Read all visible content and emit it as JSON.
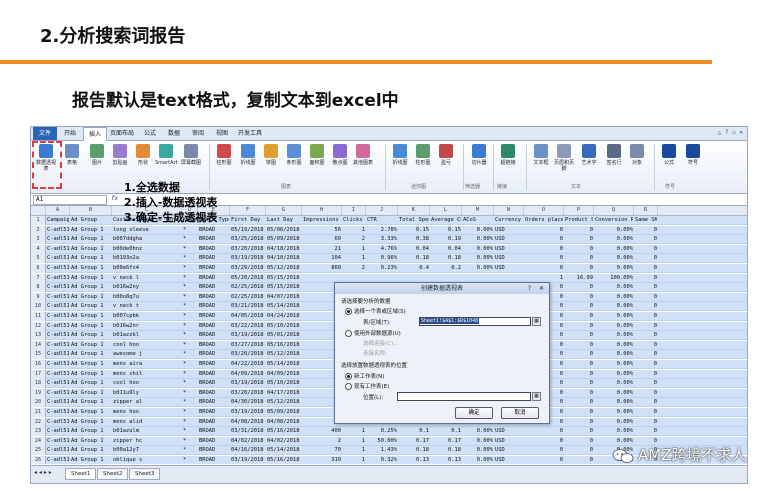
{
  "slide": {
    "title": "2.分析搜索词报告",
    "subtitle": "报告默认是text格式，复制文本到excel中",
    "watermark": "AMZ跨境不求人"
  },
  "colors": {
    "accent": "#f08a24",
    "selection": "#cfe0f7",
    "file_tab": "#2a62b8",
    "highlight": "#e23b3b"
  },
  "excel": {
    "tabs": [
      "文件",
      "开始",
      "插入",
      "页面布局",
      "公式",
      "数据",
      "审阅",
      "视图",
      "开发工具"
    ],
    "active_tab": "插入",
    "ribbon_buttons": [
      "数据透视表",
      "表格",
      "图片",
      "剪贴画",
      "形状",
      "SmartArt",
      "屏幕截图",
      "柱形图",
      "折线图",
      "饼图",
      "条形图",
      "面积图",
      "散点图",
      "其他图表",
      "折线图",
      "柱形图",
      "盈亏",
      "切片器",
      "超链接",
      "文本框",
      "页眉和页脚",
      "艺术字",
      "签名行",
      "对象",
      "公式",
      "符号"
    ],
    "ribbon_groups": [
      "图表",
      "迷你图",
      "筛选器",
      "链接",
      "文本",
      "符号"
    ],
    "name_box": "A1",
    "fx": "fx",
    "columns": [
      "A",
      "B",
      "C",
      "D",
      "E",
      "F",
      "G",
      "H",
      "I",
      "J",
      "K",
      "L",
      "M",
      "N",
      "O",
      "P",
      "Q",
      "R"
    ],
    "sheet_tabs": [
      "Sheet1",
      "Sheet2",
      "Sheet3"
    ]
  },
  "steps": [
    "1.全选数据",
    "2.插入-数据透视表",
    "3.确定-生成透视表"
  ],
  "table": {
    "headers": [
      "Campaign",
      "Ad Group",
      "Customer Search Term",
      "Keyword",
      "Match Type",
      "First Day",
      "Last Day",
      "Impressions",
      "Clicks",
      "CTR",
      "Total Spend",
      "Average CPC",
      "ACoS",
      "Currency",
      "Orders placed",
      "Product Sales",
      "Conversion Rate",
      "Same SKU Or"
    ],
    "rows": [
      [
        "C-adl51",
        "Ad Group 1",
        "long sleeve",
        "*",
        "BROAD",
        "05/19/2018",
        "05/06/2018",
        "56",
        "1",
        "2.78%",
        "0.15",
        "0.15",
        "0.00%",
        "USD",
        "0",
        "0",
        "0.00%",
        "0"
      ],
      [
        "C-adl51",
        "Ad Group 1",
        "b007ddgha",
        "*",
        "BROAD",
        "03/25/2018",
        "05/09/2018",
        "60",
        "2",
        "3.33%",
        "0.38",
        "0.19",
        "0.00%",
        "USD",
        "0",
        "0",
        "0.00%",
        "0"
      ],
      [
        "C-adl51",
        "Ad Group 1",
        "b00de0hnz",
        "*",
        "BROAD",
        "03/20/2018",
        "04/18/2018",
        "21",
        "1",
        "4.76%",
        "0.04",
        "0.04",
        "0.00%",
        "USD",
        "0",
        "0",
        "0.00%",
        "0"
      ],
      [
        "C-adl51",
        "Ad Group 1",
        "b0193o2a",
        "*",
        "BROAD",
        "03/19/2018",
        "04/10/2018",
        "104",
        "1",
        "0.96%",
        "0.18",
        "0.18",
        "0.00%",
        "USD",
        "0",
        "0",
        "0.00%",
        "0"
      ],
      [
        "C-adl51",
        "Ad Group 1",
        "b00e6fx4",
        "*",
        "BROAD",
        "03/29/2018",
        "05/12/2018",
        "860",
        "2",
        "0.23%",
        "0.4",
        "0.2",
        "0.00%",
        "USD",
        "0",
        "0",
        "0.00%",
        "0"
      ],
      [
        "C-adl51",
        "Ad Group 1",
        "v neck l",
        "*",
        "BROAD",
        "05/20/2018",
        "05/15/2018",
        "",
        "",
        "",
        "",
        "",
        "",
        "",
        "1",
        "16.99",
        "100.00%",
        "0"
      ],
      [
        "C-adl51",
        "Ad Group 1",
        "b016w2ny",
        "*",
        "BROAD",
        "02/25/2018",
        "05/15/2018",
        "",
        "",
        "",
        "",
        "",
        "",
        "",
        "0",
        "0",
        "0.00%",
        "0"
      ],
      [
        "C-adl51",
        "Ad Group 1",
        "b00o8q7u",
        "*",
        "BROAD",
        "02/25/2018",
        "04/07/2018",
        "",
        "",
        "",
        "",
        "",
        "",
        "",
        "0",
        "0",
        "0.00%",
        "0"
      ],
      [
        "C-adl51",
        "Ad Group 1",
        "v neck t",
        "*",
        "BROAD",
        "03/21/2018",
        "05/14/2018",
        "",
        "",
        "",
        "",
        "",
        "",
        "",
        "0",
        "0",
        "0.00%",
        "0"
      ],
      [
        "C-adl51",
        "Ad Group 1",
        "b007cpbk",
        "*",
        "BROAD",
        "04/05/2018",
        "04/24/2018",
        "",
        "",
        "",
        "",
        "",
        "",
        "",
        "0",
        "0",
        "0.00%",
        "0"
      ],
      [
        "C-adl51",
        "Ad Group 1",
        "b016w2nr",
        "*",
        "BROAD",
        "03/22/2018",
        "05/10/2018",
        "",
        "",
        "",
        "",
        "",
        "",
        "",
        "0",
        "0",
        "0.00%",
        "0"
      ],
      [
        "C-adl51",
        "Ad Group 1",
        "b01azzkl",
        "*",
        "BROAD",
        "03/19/2018",
        "05/01/2018",
        "",
        "",
        "",
        "",
        "",
        "",
        "",
        "0",
        "0",
        "0.00%",
        "0"
      ],
      [
        "C-adl51",
        "Ad Group 1",
        "cool hoo",
        "*",
        "BROAD",
        "03/27/2018",
        "05/16/2018",
        "",
        "",
        "",
        "",
        "",
        "",
        "",
        "0",
        "0",
        "0.00%",
        "0"
      ],
      [
        "C-adl51",
        "Ad Group 1",
        "awesome j",
        "*",
        "BROAD",
        "03/20/2018",
        "05/12/2018",
        "",
        "",
        "",
        "",
        "",
        "",
        "",
        "0",
        "0",
        "0.00%",
        "0"
      ],
      [
        "C-adl51",
        "Ad Group 1",
        "mens aira",
        "*",
        "BROAD",
        "04/22/2018",
        "05/14/2018",
        "",
        "",
        "",
        "",
        "",
        "",
        "",
        "0",
        "0",
        "0.00%",
        "0"
      ],
      [
        "C-adl51",
        "Ad Group 1",
        "mens shil",
        "*",
        "BROAD",
        "04/09/2018",
        "04/09/2018",
        "",
        "",
        "",
        "",
        "",
        "",
        "",
        "0",
        "0",
        "0.00%",
        "0"
      ],
      [
        "C-adl51",
        "Ad Group 1",
        "cool hoo",
        "*",
        "BROAD",
        "03/19/2018",
        "05/10/2018",
        "",
        "",
        "",
        "",
        "",
        "",
        "",
        "0",
        "0",
        "0.00%",
        "0"
      ],
      [
        "C-adl51",
        "Ad Group 1",
        "b011u9ly",
        "*",
        "BROAD",
        "03/20/2018",
        "04/17/2018",
        "",
        "",
        "",
        "",
        "",
        "",
        "",
        "0",
        "0",
        "0.00%",
        "0"
      ],
      [
        "C-adl51",
        "Ad Group 1",
        "zipper al",
        "*",
        "BROAD",
        "04/30/2018",
        "05/12/2018",
        "",
        "",
        "",
        "",
        "",
        "",
        "",
        "0",
        "0",
        "0.00%",
        "0"
      ],
      [
        "C-adl51",
        "Ad Group 1",
        "mens hoo",
        "*",
        "BROAD",
        "03/19/2018",
        "05/09/2018",
        "",
        "",
        "",
        "",
        "",
        "",
        "",
        "0",
        "0",
        "0.00%",
        "0"
      ],
      [
        "C-adl51",
        "Ad Group 1",
        "mens alid",
        "*",
        "BROAD",
        "04/08/2018",
        "04/08/2018",
        "1",
        "1",
        "100.00%",
        "0.11",
        "0.11",
        "0.00%",
        "USD",
        "0",
        "0",
        "0.00%",
        "0"
      ],
      [
        "C-adl51",
        "Ad Group 1",
        "b01azulm",
        "*",
        "BROAD",
        "03/31/2018",
        "05/16/2018",
        "400",
        "1",
        "0.25%",
        "0.1",
        "0.1",
        "0.00%",
        "USD",
        "0",
        "0",
        "0.00%",
        "0"
      ],
      [
        "C-adl51",
        "Ad Group 1",
        "zipper hc",
        "*",
        "BROAD",
        "04/02/2018",
        "04/02/2018",
        "2",
        "1",
        "50.00%",
        "0.17",
        "0.17",
        "0.00%",
        "USD",
        "0",
        "0",
        "0.00%",
        "0"
      ],
      [
        "C-adl51",
        "Ad Group 1",
        "b00a12y7",
        "*",
        "BROAD",
        "04/16/2018",
        "05/14/2018",
        "70",
        "1",
        "1.43%",
        "0.18",
        "0.18",
        "0.00%",
        "USD",
        "0",
        "0",
        "0.00%",
        "0"
      ],
      [
        "C-adl51",
        "Ad Group 1",
        "oblique s",
        "*",
        "BROAD",
        "03/19/2018",
        "05/16/2018",
        "310",
        "1",
        "0.32%",
        "0.13",
        "0.13",
        "0.00%",
        "USD",
        "0",
        "0",
        "0.00%",
        "0"
      ]
    ]
  },
  "dialog": {
    "title": "创建数据透视表",
    "section1": "请选择要分析的数据",
    "opt_table": "选择一个表或区域(S)",
    "range_label": "表/区域(T):",
    "range_value": "Sheet1!$A$1:$R$1048",
    "opt_external": "使用外部数据源(U)",
    "choose_conn": "选择连接(C)...",
    "conn_name": "连接名称:",
    "section2": "选择放置数据透视表的位置",
    "opt_new": "新工作表(N)",
    "opt_existing": "现有工作表(E)",
    "location_label": "位置(L):",
    "ok": "确定",
    "cancel": "取消"
  }
}
